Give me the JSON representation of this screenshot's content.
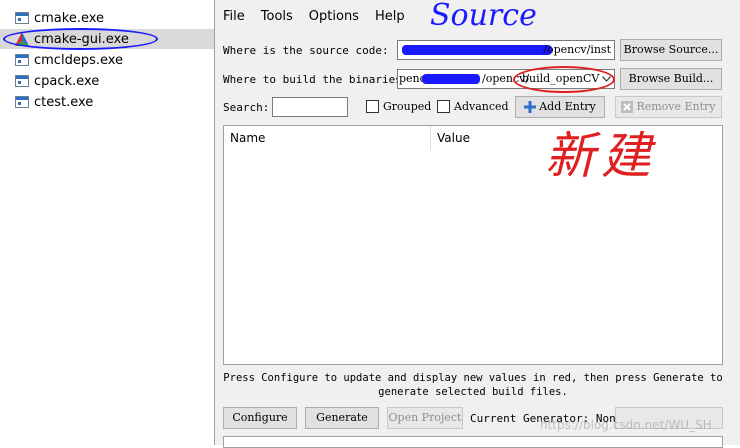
{
  "explorer": {
    "items": [
      {
        "label": "cmake.exe",
        "icon": "exe-file-icon"
      },
      {
        "label": "cmake-gui.exe",
        "icon": "cmake-triangle-icon",
        "selected": true
      },
      {
        "label": "cmcldeps.exe",
        "icon": "exe-file-icon"
      },
      {
        "label": "cpack.exe",
        "icon": "exe-file-icon"
      },
      {
        "label": "ctest.exe",
        "icon": "exe-file-icon"
      }
    ]
  },
  "menu": {
    "file": "File",
    "tools": "Tools",
    "options": "Options",
    "help": "Help"
  },
  "source": {
    "label": "Where is the source code:",
    "value_visible": "/opencv/inst",
    "browse": "Browse Source..."
  },
  "build": {
    "label": "Where to build the binaries:",
    "value_prefix": "penc",
    "value_mid": "/opencv/",
    "value_visible": "build_openCV",
    "browse": "Browse Build..."
  },
  "search": {
    "label": "Search:",
    "value": ""
  },
  "options": {
    "grouped": "Grouped",
    "advanced": "Advanced"
  },
  "entries": {
    "add": "Add Entry",
    "remove": "Remove Entry"
  },
  "table": {
    "col_name": "Name",
    "col_value": "Value"
  },
  "hint": {
    "line1": "Press Configure to update and display new values in red, then press Generate to",
    "line2": "generate selected build files."
  },
  "actions": {
    "configure": "Configure",
    "generate": "Generate",
    "open_project": "Open Project",
    "current_generator": "Current Generator: None"
  },
  "annotations": {
    "source_note": "Source",
    "new_note": "新建"
  },
  "watermark": "https://blog.csdn.net/WU_SH",
  "colors": {
    "annotation_blue": "#1a1aff",
    "annotation_red": "#e02020"
  }
}
